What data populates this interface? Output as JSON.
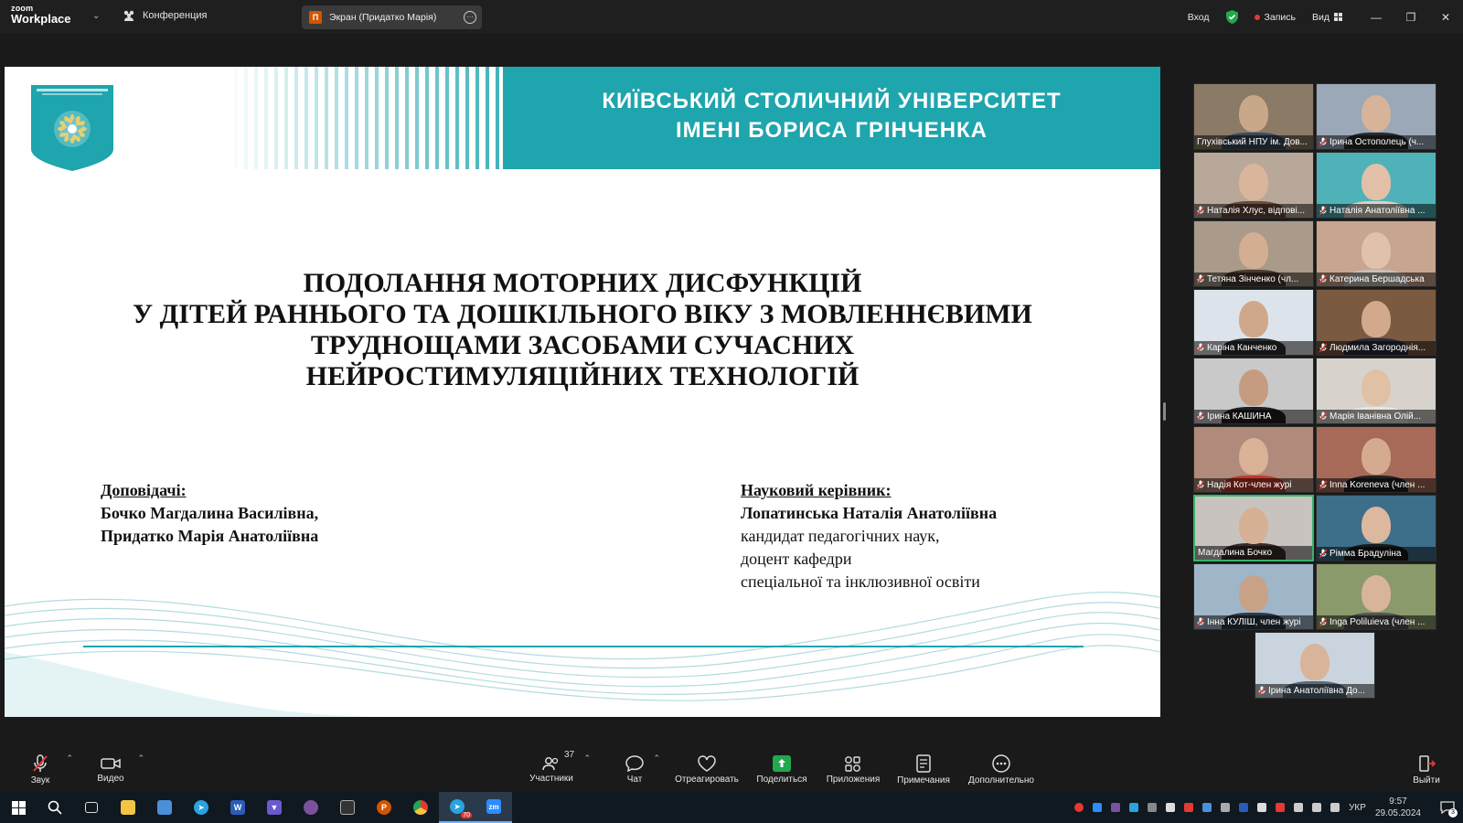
{
  "topbar": {
    "logo_line1": "zoom",
    "logo_line2": "Workplace",
    "conference_label": "Конференция",
    "share_label": "Экран (Придатко Марія)",
    "share_icon_letter": "П",
    "signin_label": "Вход",
    "record_label": "Запись",
    "view_label": "Вид"
  },
  "slide": {
    "university_line1": "КИЇВСЬКИЙ СТОЛИЧНИЙ УНІВЕРСИТЕТ",
    "university_line2": "ІМЕНІ БОРИСА ГРІНЧЕНКА",
    "title_lines": [
      "ПОДОЛАННЯ МОТОРНИХ ДИСФУНКЦІЙ",
      "У ДІТЕЙ РАННЬОГО ТА ДОШКІЛЬНОГО ВІКУ З МОВЛЕННЄВИМИ",
      "ТРУДНОЩАМИ ЗАСОБАМИ СУЧАСНИХ",
      "НЕЙРОСТИМУЛЯЦІЙНИХ ТЕХНОЛОГІЙ"
    ],
    "speakers_header": "Доповідачі:",
    "speakers": [
      "Бочко Магдалина Василівна,",
      "Придатко Марія Анатоліївна"
    ],
    "advisor_header": "Науковий керівник:",
    "advisor_name": "Лопатинська Наталія Анатоліївна",
    "advisor_details": [
      "кандидат педагогічних наук,",
      "доцент кафедри",
      "спеціальної та інклюзивної освіти"
    ]
  },
  "gallery": [
    {
      "name": "Глухівський НПУ ім. Дов...",
      "muted": false,
      "bg": "#8a7a66",
      "skin": "#c9a88a",
      "shirt": "#3b4a5c"
    },
    {
      "name": "Ірина Остополець (ч...",
      "muted": true,
      "bg": "#9aa8b8",
      "skin": "#d7b39a",
      "shirt": "#2a2a2a"
    },
    {
      "name": "Наталія Хлус, відпові...",
      "muted": true,
      "bg": "#b8a89a",
      "skin": "#d9b59b",
      "shirt": "#6b4a3a"
    },
    {
      "name": "Наталія Анатоліївна ...",
      "muted": true,
      "bg": "#4fb2b8",
      "skin": "#e2c0a8",
      "shirt": "#d9d2c8"
    },
    {
      "name": "Тетяна Зінченко (чл...",
      "muted": true,
      "bg": "#a99a8a",
      "skin": "#d4ae92",
      "shirt": "#4a3a30"
    },
    {
      "name": "Катерина Бершадська",
      "muted": true,
      "bg": "#c7a58e",
      "skin": "#e0c2aa",
      "shirt": "#c8c0b8"
    },
    {
      "name": "Каріна Канченко",
      "muted": true,
      "bg": "#dde3ea",
      "skin": "#cfa88c",
      "shirt": "#2f2f2f"
    },
    {
      "name": "Людмила Загороднія...",
      "muted": true,
      "bg": "#7a5a40",
      "skin": "#d2a98c",
      "shirt": "#2a2a3a"
    },
    {
      "name": "Ірина КАШИНА",
      "muted": true,
      "bg": "#c9c9c9",
      "skin": "#c69c80",
      "shirt": "#1f1f1f"
    },
    {
      "name": "Марія Іванівна Олій...",
      "muted": true,
      "bg": "#d7d2cc",
      "skin": "#e1c1a6",
      "shirt": "#e8e4de"
    },
    {
      "name": "Надія Кот-член журі",
      "muted": true,
      "bg": "#b08a7a",
      "skin": "#d9b297",
      "shirt": "#c0392b"
    },
    {
      "name": "Inna Koreneva (член ...",
      "muted": true,
      "bg": "#a86a58",
      "skin": "#d4ab90",
      "shirt": "#222"
    },
    {
      "name": "Магдалина Бочко",
      "muted": false,
      "bg": "#c8c3be",
      "skin": "#d6b196",
      "shirt": "#3a2d28"
    },
    {
      "name": "Рімма Брадуліна",
      "muted": true,
      "bg": "#3d6e8a",
      "skin": "#dcb89e",
      "shirt": "#1a1a1a"
    },
    {
      "name": "Інна КУЛІШ, член журі",
      "muted": true,
      "bg": "#9fb6c8",
      "skin": "#c8a286",
      "shirt": "#2d3a48"
    },
    {
      "name": "Inga Poliluieva (член ...",
      "muted": true,
      "bg": "#8a9a6a",
      "skin": "#d8b59a",
      "shirt": "#555"
    },
    {
      "name": "Ірина Анатоліївна До...",
      "muted": true,
      "bg": "#c9d4de",
      "skin": "#d8b49a",
      "shirt": "#5a6a7a"
    }
  ],
  "toolbar": {
    "audio_label": "Звук",
    "video_label": "Видео",
    "participants_label": "Участники",
    "participants_count": "37",
    "chat_label": "Чат",
    "react_label": "Отреагировать",
    "share_label": "Поделиться",
    "apps_label": "Приложения",
    "notes_label": "Примечания",
    "more_label": "Дополнительно",
    "leave_label": "Выйти"
  },
  "taskbar": {
    "language": "УКР",
    "time": "9:57",
    "date": "29.05.2024",
    "notification_count": "3",
    "telegram_badge": "70"
  },
  "colors": {
    "accent_teal": "#1ea5ad",
    "active_speaker_border": "#36b36b",
    "share_green": "#23a74f",
    "mute_red": "#e53935"
  }
}
